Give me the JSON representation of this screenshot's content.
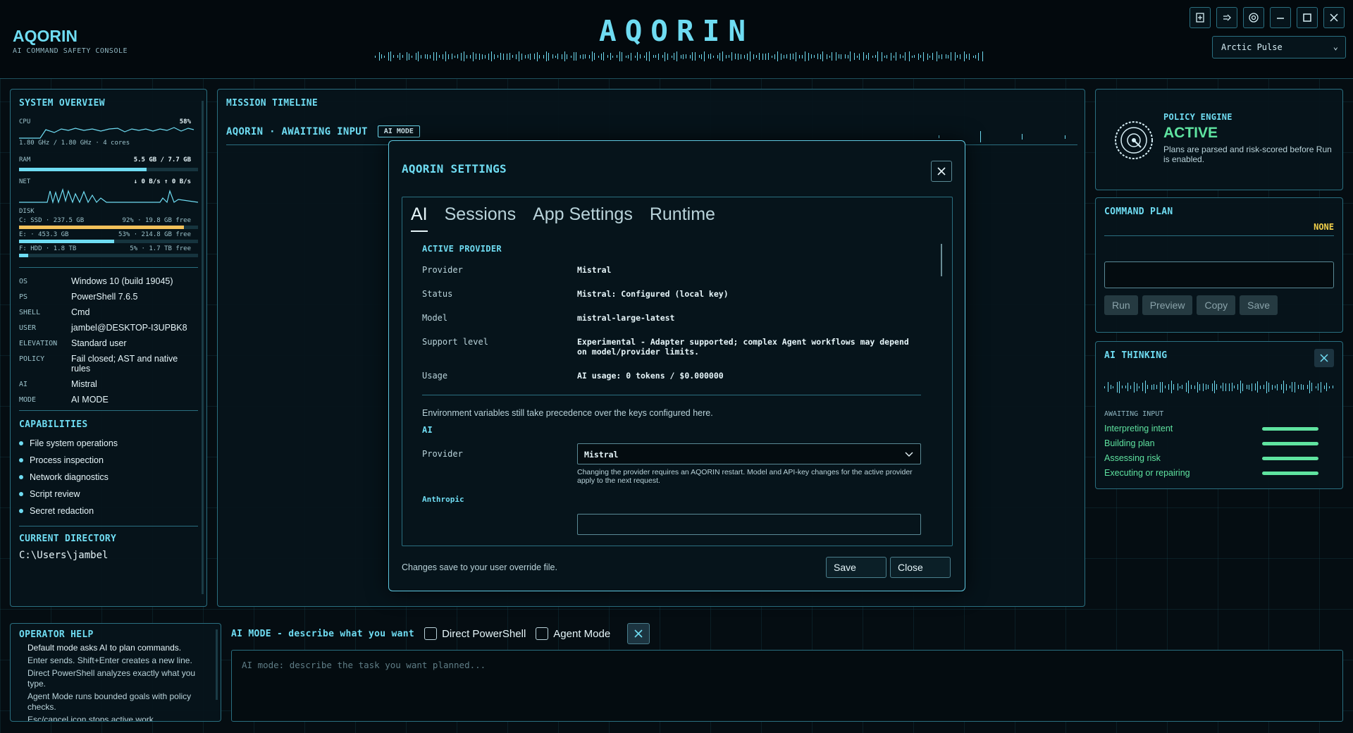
{
  "header": {
    "app_name": "AQORIN",
    "app_subtitle": "AI COMMAND SAFETY CONSOLE",
    "big_title": "AQORIN",
    "theme_select": "Arctic Pulse",
    "icons": [
      "export-icon",
      "logout-icon",
      "settings-icon",
      "minimize-icon",
      "maximize-icon",
      "close-icon"
    ]
  },
  "system": {
    "title": "SYSTEM OVERVIEW",
    "cpu_label": "CPU",
    "cpu_pct": "58%",
    "cpu_detail": "1.80 GHz / 1.80 GHz · 4 cores",
    "ram_label": "RAM",
    "ram_value": "5.5 GB / 7.7 GB",
    "ram_fraction": 0.714,
    "net_label": "NET",
    "net_value": "↓ 0 B/s  ↑ 0 B/s",
    "disk_label": "DISK",
    "disks": [
      {
        "name": "C: SSD · 237.5 GB",
        "detail": "92% · 19.8 GB free",
        "fraction": 0.92,
        "color": "#f2c15a"
      },
      {
        "name": "E: · 453.3 GB",
        "detail": "53% · 214.8 GB free",
        "fraction": 0.53,
        "color": "#6fdcf2"
      },
      {
        "name": "F: HDD · 1.8 TB",
        "detail": "5% · 1.7 TB free",
        "fraction": 0.05,
        "color": "#6fdcf2"
      }
    ],
    "info": [
      {
        "k": "OS",
        "v": "Windows 10 (build 19045)"
      },
      {
        "k": "PS",
        "v": "PowerShell 7.6.5"
      },
      {
        "k": "SHELL",
        "v": "Cmd"
      },
      {
        "k": "USER",
        "v": "jambel@DESKTOP-I3UPBK8"
      },
      {
        "k": "ELEVATION",
        "v": "Standard user"
      },
      {
        "k": "POLICY",
        "v": "Fail closed; AST and native rules"
      },
      {
        "k": "AI",
        "v": "Mistral"
      },
      {
        "k": "MODE",
        "v": "AI MODE"
      }
    ],
    "capabilities_title": "CAPABILITIES",
    "capabilities": [
      "File system operations",
      "Process inspection",
      "Network diagnostics",
      "Script review",
      "Secret redaction"
    ],
    "current_dir_title": "CURRENT DIRECTORY",
    "current_dir": "C:\\Users\\jambel"
  },
  "timeline": {
    "title": "MISSION TIMELINE",
    "status": "AQORIN · AWAITING INPUT",
    "mode_badge": "AI MODE"
  },
  "settings": {
    "title": "AQORIN SETTINGS",
    "tabs": [
      "AI",
      "Sessions",
      "App Settings",
      "Runtime"
    ],
    "active_provider_title": "ACTIVE PROVIDER",
    "rows": [
      {
        "k": "Provider",
        "v": "Mistral"
      },
      {
        "k": "Status",
        "v": "Mistral: Configured (local key)"
      },
      {
        "k": "Model",
        "v": "mistral-large-latest"
      },
      {
        "k": "Support level",
        "v": "Experimental - Adapter supported; complex Agent workflows may depend on model/provider limits."
      },
      {
        "k": "Usage",
        "v": "AI usage: 0 tokens / $0.000000"
      }
    ],
    "env_note": "Environment variables still take precedence over the keys configured here.",
    "ai_section": "AI",
    "provider_label": "Provider",
    "provider_value": "Mistral",
    "provider_help": "Changing the provider requires an AQORIN restart. Model and API-key changes for the active provider apply to the next request.",
    "anthropic_label": "Anthropic",
    "footer_note": "Changes save to your user override file.",
    "save_label": "Save",
    "close_label": "Close"
  },
  "policy": {
    "title": "POLICY ENGINE",
    "state": "ACTIVE",
    "desc": "Plans are parsed and risk-scored before Run is enabled."
  },
  "command_plan": {
    "title": "COMMAND PLAN",
    "risk": "NONE",
    "buttons": [
      "Run",
      "Preview",
      "Copy",
      "Save"
    ]
  },
  "thinking": {
    "title": "AI THINKING",
    "status": "AWAITING INPUT",
    "steps": [
      "Interpreting intent",
      "Building plan",
      "Assessing risk",
      "Executing or repairing"
    ]
  },
  "operator_help": {
    "title": "OPERATOR HELP",
    "lines": [
      "Default mode asks AI to plan commands.",
      "Enter sends. Shift+Enter creates a new line.",
      "Direct PowerShell analyzes exactly what you type.",
      "Agent Mode runs bounded goals with policy checks.",
      "Esc/cancel icon stops active work."
    ]
  },
  "input": {
    "mode_label": "AI MODE - describe what you want",
    "direct_ps": "Direct PowerShell",
    "agent_mode": "Agent Mode",
    "placeholder": "AI mode: describe the task you want planned..."
  }
}
